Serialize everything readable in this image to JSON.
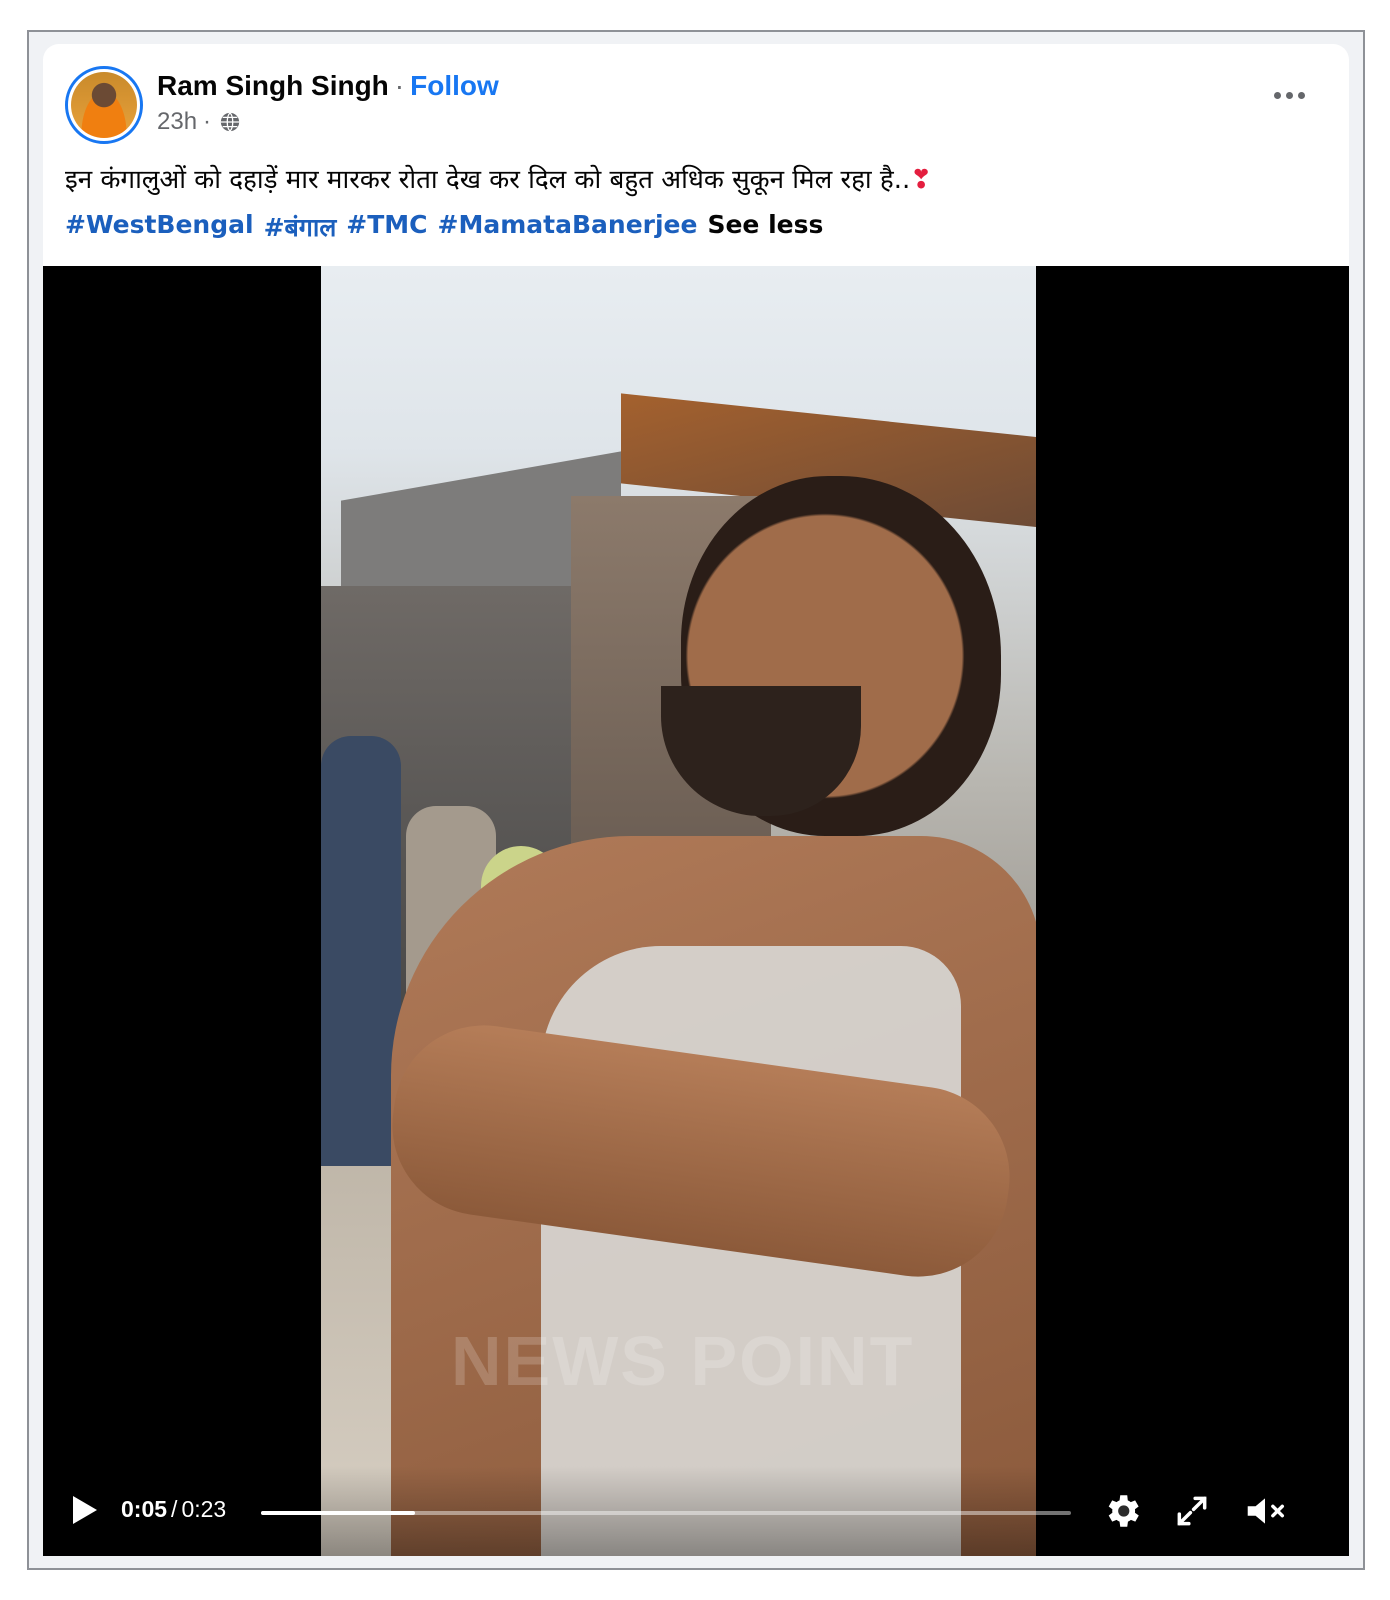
{
  "post": {
    "author_name": "Ram Singh Singh",
    "separator": "·",
    "follow_label": "Follow",
    "timestamp": "23h",
    "meta_separator": "·",
    "privacy_icon": "globe-icon",
    "more_icon": "more-options-icon",
    "text": "इन कंगालुओं को दहाड़ें मार मारकर रोता देख कर दिल को बहुत अधिक सुकून मिल रहा है..",
    "text_emoji": "❣",
    "hashtags": [
      "#WestBengal",
      "#बंगाल",
      "#TMC",
      "#MamataBanerjee"
    ],
    "see_less_label": "See less"
  },
  "video": {
    "watermark": "NEWS POINT",
    "current_time": "0:05",
    "time_separator": "/",
    "duration": "0:23",
    "progress_fraction": 0.19,
    "icons": [
      "play-icon",
      "settings-icon",
      "fullscreen-icon",
      "muted-volume-icon"
    ]
  },
  "colors": {
    "accent": "#1877f2",
    "hashtag": "#1b5fbd",
    "secondary_text": "#65676b",
    "heart": "#e41e3f"
  }
}
